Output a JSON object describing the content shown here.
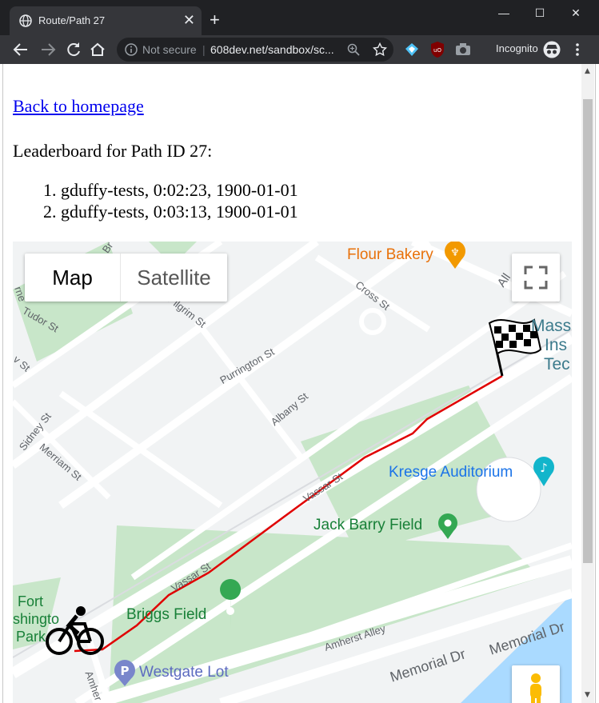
{
  "browser": {
    "tab_title": "Route/Path 27",
    "tab_close": "✕",
    "new_tab": "+",
    "minimize": "—",
    "maximize": "☐",
    "close": "✕",
    "security_label": "Not secure",
    "url": "608dev.net/sandbox/sc...",
    "mode_label": "Incognito"
  },
  "page": {
    "back_link": "Back to homepage",
    "leaderboard_title": "Leaderboard for Path ID 27:",
    "entries": [
      "gduffy-tests, 0:02:23, 1900-01-01",
      "gduffy-tests, 0:03:13, 1900-01-01"
    ]
  },
  "map": {
    "map_button": "Map",
    "satellite_button": "Satellite",
    "labels": {
      "flour_bakery": "Flour Bakery",
      "cross_st": "Cross St",
      "tudor_st": "Tudor St",
      "pilgrim_st": "Pilgrim St",
      "purrington_st": "Purrington St",
      "albany_st": "Albany St",
      "sidney_st": "Sidney St",
      "merriam_st": "Merriam St",
      "vassar_st_1": "Vassar St",
      "vassar_st_2": "Vassar St",
      "kresge": "Kresge Auditorium",
      "jack_barry": "Jack Barry Field",
      "briggs": "Briggs Field",
      "westgate": "Westgate Lot",
      "amherst_alley": "Amherst Alley",
      "memorial_dr_1": "Memorial Dr",
      "memorial_dr_2": "Memorial Dr",
      "fort_1": "Fort",
      "fort_2": "shingto",
      "fort_3": "Park",
      "mass_1": "Mass",
      "mass_2": "Ins",
      "mass_3": "Tec",
      "allen": "All",
      "br": "Br",
      "rne": "rne",
      "v_st": "v St",
      "amherst": "Amher"
    },
    "route_color": "#e00000",
    "colors": {
      "park": "#c5e8c5",
      "road": "#ffffff",
      "block": "#e8eaed",
      "water": "#aadaff"
    }
  }
}
